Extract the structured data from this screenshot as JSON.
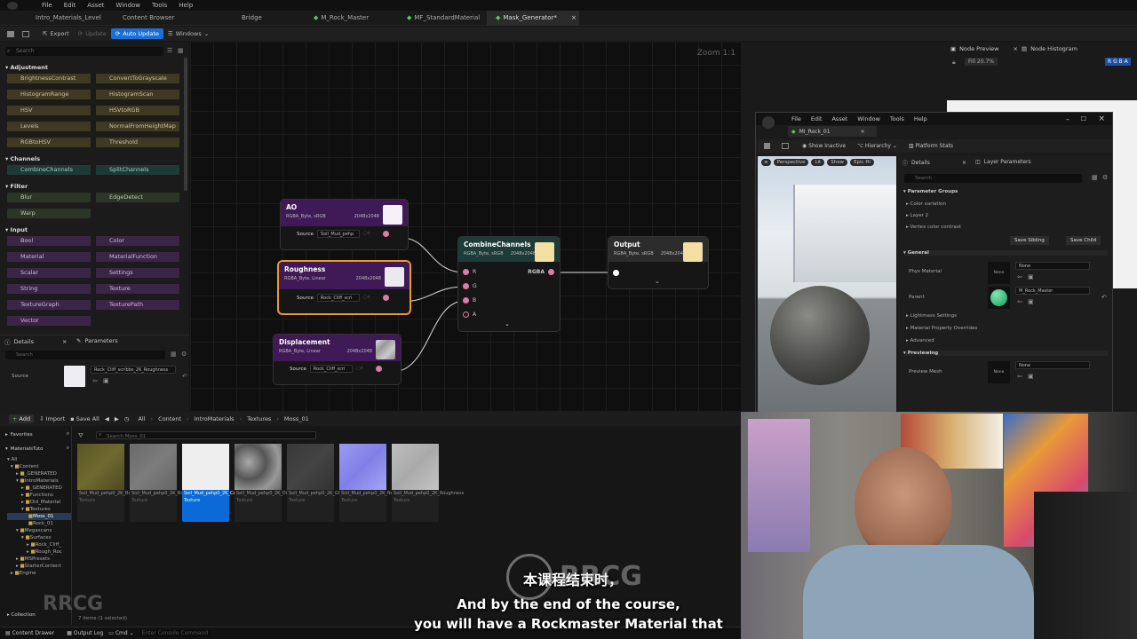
{
  "menubar": {
    "items": [
      "File",
      "Edit",
      "Asset",
      "Window",
      "Tools",
      "Help"
    ]
  },
  "tabs": [
    "Intro_Materials_Level",
    "Content Browser",
    "Bridge",
    "M_Rock_Master",
    "MF_StandardMaterial",
    "Mask_Generator*"
  ],
  "toolbar": {
    "export": "Export",
    "update": "Update",
    "auto_update": "Auto Update",
    "windows": "Windows"
  },
  "left": {
    "search_placeholder": "Search",
    "sections": {
      "adjustment": "Adjustment",
      "channels": "Channels",
      "filter": "Filter",
      "input": "Input"
    },
    "adjustment": [
      "BrightnessContrast",
      "ConvertToGrayscale",
      "HistogramRange",
      "HistogramScan",
      "HSV",
      "HSVtoRGB",
      "Levels",
      "NormalFromHeightMap",
      "RGBtoHSV",
      "Threshold"
    ],
    "channels": [
      "CombineChannels",
      "SplitChannels"
    ],
    "filter": [
      "Blur",
      "EdgeDetect",
      "Warp"
    ],
    "input": [
      "Bool",
      "Color",
      "Material",
      "MaterialFunction",
      "Scalar",
      "Settings",
      "String",
      "Texture",
      "TextureGraph",
      "TexturePath",
      "Vector"
    ]
  },
  "details": {
    "tab1": "Details",
    "tab2": "Parameters",
    "search": "Search",
    "source_label": "Source",
    "source_value": "Rock_Cliff_scribbs_2K_Roughness"
  },
  "canvas": {
    "zoom": "Zoom 1:1"
  },
  "nodes": {
    "ao": {
      "title": "AO",
      "sub": "RGBA_Byte, sRGB",
      "res": "2048x2048",
      "src": "Source",
      "srcv": "Soil_Mud_pehp"
    },
    "rough": {
      "title": "Roughness",
      "sub": "RGBA_Byte, Linear",
      "res": "2048x2048",
      "src": "Source",
      "srcv": "Rock_Cliff_scri"
    },
    "disp": {
      "title": "Displacement",
      "sub": "RGBA_Byte, Linear",
      "res": "2048x2048",
      "src": "Source",
      "srcv": "Rock_Cliff_scri"
    },
    "combine": {
      "title": "CombineChannels",
      "sub": "RGBA_Byte, sRGB",
      "res": "2048x2048",
      "r": "R",
      "g": "G",
      "b": "B",
      "a": "A",
      "out": "RGBA"
    },
    "output": {
      "title": "Output",
      "sub": "RGBA_Byte, sRGB",
      "res": "2048x2048"
    }
  },
  "nodepreview": {
    "tab1": "Node Preview",
    "tab2": "Node Histogram",
    "fill": "Fill 20.7%",
    "rgba": "R G B A"
  },
  "matwin": {
    "menu": [
      "File",
      "Edit",
      "Asset",
      "Window",
      "Tools",
      "Help"
    ],
    "tab": "MI_Rock_01",
    "toolbar": {
      "show_inactive": "Show Inactive",
      "hierarchy": "Hierarchy",
      "platform_stats": "Platform Stats"
    },
    "vp": {
      "perspective": "Perspective",
      "lit": "Lit",
      "show": "Show",
      "epic": "Epic Hi"
    },
    "details_tab": "Details",
    "layer_tab": "Layer Parameters",
    "search": "Search",
    "param_groups": "Parameter Groups",
    "color_variation": "Color variation",
    "layer2": "Layer 2",
    "vertex": "Vertex color contrast",
    "save_sibling": "Save Sibling",
    "save_child": "Save Child",
    "general": "General",
    "phys_material": "Phys Material",
    "none": "None",
    "parent": "Parent",
    "parent_value": "M_Rock_Master",
    "lightmass": "Lightmass Settings",
    "overrides": "Material Property Overrides",
    "advanced": "Advanced",
    "previewing": "Previewing",
    "preview_mesh": "Preview Mesh"
  },
  "content": {
    "add": "Add",
    "import": "Import",
    "save_all": "Save All",
    "breadcrumb": [
      "All",
      "Content",
      "IntroMaterials",
      "Textures",
      "Moss_01"
    ],
    "favorites": "Favorites",
    "root": "MaterialsTuto",
    "search_placeholder": "Search Moss_01",
    "tree": [
      "All",
      "Content",
      "_GENERATED",
      "IntroMaterials",
      "_GENERATED",
      "Functions",
      "Old_Material",
      "Textures",
      "Moss_01",
      "Rock_01",
      "Megascans",
      "Surfaces",
      "Rock_Cliff_",
      "Rough_Roc",
      "MSPresets",
      "StarterContent",
      "Engine"
    ],
    "assets": [
      {
        "name": "Soil_Mud_pehp0_2K_BaseColor",
        "type": "Texture",
        "color": "#5e5a26"
      },
      {
        "name": "Soil_Mud_pehp0_2K_Bump",
        "type": "Texture",
        "color": "#707070"
      },
      {
        "name": "Soil_Mud_pehp0_2K_Cavity",
        "type": "Texture",
        "color": "#ededed"
      },
      {
        "name": "Soil_Mud_pehp0_2K_Displacement",
        "type": "Texture",
        "color": "#8a8a8a"
      },
      {
        "name": "Soil_Mud_pehp0_2K_Gloss",
        "type": "Texture",
        "color": "#3a3a3a"
      },
      {
        "name": "Soil_Mud_pehp0_2K_Normal",
        "type": "Texture",
        "color": "#8c8cf0"
      },
      {
        "name": "Soil_Mud_pehp0_2K_Roughness",
        "type": "Texture",
        "color": "#b8b8b8"
      }
    ],
    "collections": "Collection",
    "status": "7 items (1 selected)"
  },
  "statusbar": {
    "drawer": "Content Drawer",
    "output": "Output Log",
    "cmd": "Cmd",
    "console": "Enter Console Command"
  },
  "subtitles": {
    "zh": "本课程结束时，",
    "en1": "And by the end of the course,",
    "en2": "you will have a Rockmaster Material that"
  },
  "watermark": "RRCG"
}
